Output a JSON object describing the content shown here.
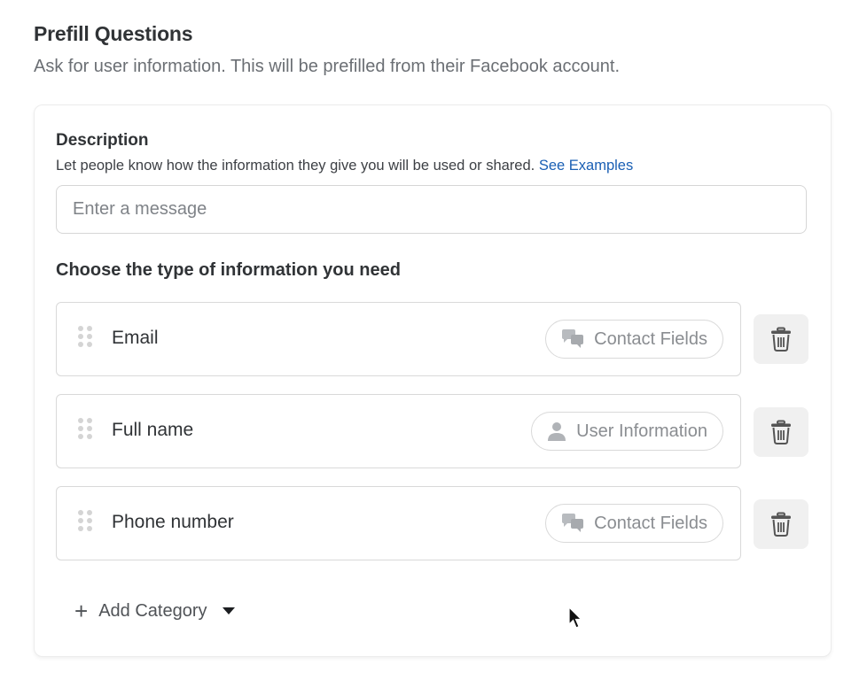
{
  "header": {
    "title": "Prefill Questions",
    "subtitle": "Ask for user information. This will be prefilled from their Facebook account."
  },
  "description": {
    "label": "Description",
    "help_text": "Let people know how the information they give you will be used or shared.",
    "link_text": "See Examples",
    "input_value": "",
    "input_placeholder": "Enter a message"
  },
  "choose_label": "Choose the type of information you need",
  "fields": [
    {
      "label": "Email",
      "category": "Contact Fields",
      "category_icon": "chat-bubbles-icon"
    },
    {
      "label": "Full name",
      "category": "User Information",
      "category_icon": "person-icon"
    },
    {
      "label": "Phone number",
      "category": "Contact Fields",
      "category_icon": "chat-bubbles-icon"
    }
  ],
  "add_category": {
    "label": "Add Category",
    "icon": "plus-icon"
  },
  "colors": {
    "link": "#1a5fb4",
    "pill_text": "#8a8d91",
    "trash_bg": "#f0f0f0"
  }
}
